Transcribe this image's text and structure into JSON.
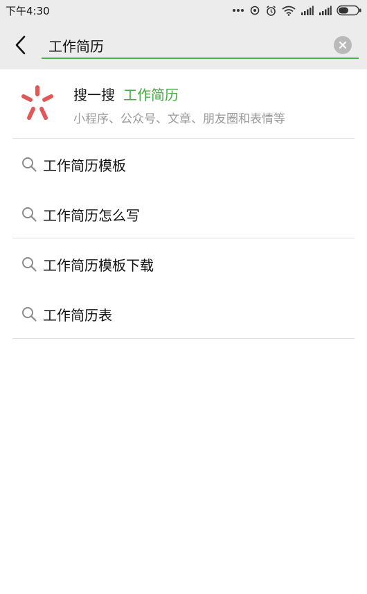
{
  "status_bar": {
    "time": "下午4:30",
    "icons": [
      "more-dots-icon",
      "sync-icon",
      "alarm-icon",
      "wifi-icon",
      "signal-icon",
      "signal-icon",
      "battery-icon"
    ]
  },
  "search": {
    "value": "工作简历",
    "accent_color": "#4caf50"
  },
  "sousou": {
    "label": "搜一搜",
    "keyword": "工作简历",
    "subtitle": "小程序、公众号、文章、朋友圈和表情等",
    "keyword_color": "#3fae3f"
  },
  "suggestions": [
    {
      "label": "工作简历模板"
    },
    {
      "label": "工作简历怎么写"
    },
    {
      "label": "工作简历模板下载"
    },
    {
      "label": "工作简历表"
    }
  ]
}
